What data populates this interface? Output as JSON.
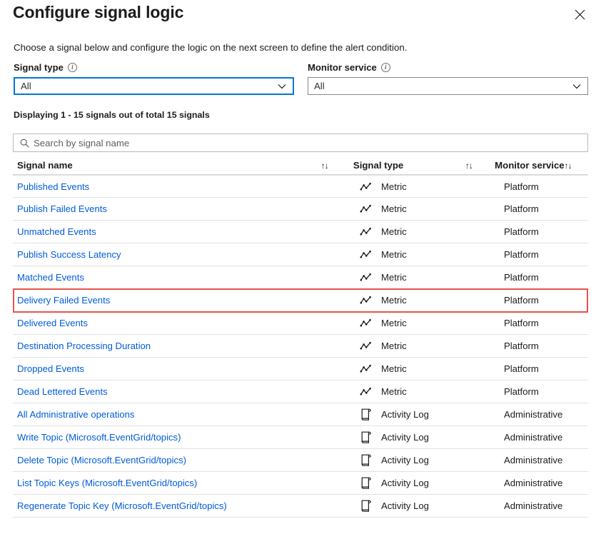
{
  "header": {
    "title": "Configure signal logic",
    "close_icon": "close-icon"
  },
  "description": "Choose a signal below and configure the logic on the next screen to define the alert condition.",
  "filters": {
    "signal_type": {
      "label": "Signal type",
      "info_icon": "info-icon",
      "value": "All",
      "options": [
        "All"
      ]
    },
    "monitor_service": {
      "label": "Monitor service",
      "info_icon": "info-icon",
      "value": "All",
      "options": [
        "All"
      ]
    }
  },
  "count_line": "Displaying 1 - 15 signals out of total 15 signals",
  "search": {
    "placeholder": "Search by signal name",
    "value": "",
    "icon": "search-icon"
  },
  "table": {
    "columns": [
      {
        "label": "Signal name",
        "sort": "↑↓"
      },
      {
        "label": "Signal type",
        "sort": "↑↓"
      },
      {
        "label": "Monitor service",
        "sort": "↑↓"
      }
    ],
    "rows": [
      {
        "name": "Published Events",
        "type": "Metric",
        "icon": "metric-line-chart-icon",
        "service": "Platform"
      },
      {
        "name": "Publish Failed Events",
        "type": "Metric",
        "icon": "metric-line-chart-icon",
        "service": "Platform"
      },
      {
        "name": "Unmatched Events",
        "type": "Metric",
        "icon": "metric-line-chart-icon",
        "service": "Platform"
      },
      {
        "name": "Publish Success Latency",
        "type": "Metric",
        "icon": "metric-line-chart-icon",
        "service": "Platform"
      },
      {
        "name": "Matched Events",
        "type": "Metric",
        "icon": "metric-line-chart-icon",
        "service": "Platform"
      },
      {
        "name": "Delivery Failed Events",
        "type": "Metric",
        "icon": "metric-line-chart-icon",
        "service": "Platform"
      },
      {
        "name": "Delivered Events",
        "type": "Metric",
        "icon": "metric-line-chart-icon",
        "service": "Platform"
      },
      {
        "name": "Destination Processing Duration",
        "type": "Metric",
        "icon": "metric-line-chart-icon",
        "service": "Platform"
      },
      {
        "name": "Dropped Events",
        "type": "Metric",
        "icon": "metric-line-chart-icon",
        "service": "Platform"
      },
      {
        "name": "Dead Lettered Events",
        "type": "Metric",
        "icon": "metric-line-chart-icon",
        "service": "Platform"
      },
      {
        "name": "All Administrative operations",
        "type": "Activity Log",
        "icon": "activity-log-scroll-icon",
        "service": "Administrative"
      },
      {
        "name": "Write Topic (Microsoft.EventGrid/topics)",
        "type": "Activity Log",
        "icon": "activity-log-scroll-icon",
        "service": "Administrative"
      },
      {
        "name": "Delete Topic (Microsoft.EventGrid/topics)",
        "type": "Activity Log",
        "icon": "activity-log-scroll-icon",
        "service": "Administrative"
      },
      {
        "name": "List Topic Keys (Microsoft.EventGrid/topics)",
        "type": "Activity Log",
        "icon": "activity-log-scroll-icon",
        "service": "Administrative"
      },
      {
        "name": "Regenerate Topic Key (Microsoft.EventGrid/topics)",
        "type": "Activity Log",
        "icon": "activity-log-scroll-icon",
        "service": "Administrative"
      }
    ]
  },
  "annotation": {
    "highlighted_row_name": "Delivery Failed Events",
    "color": "#e8544a"
  },
  "colors": {
    "link": "#015cda",
    "focus_border": "#0078d4",
    "text": "#1b1b1b",
    "row_divider": "#e1e1e1"
  }
}
